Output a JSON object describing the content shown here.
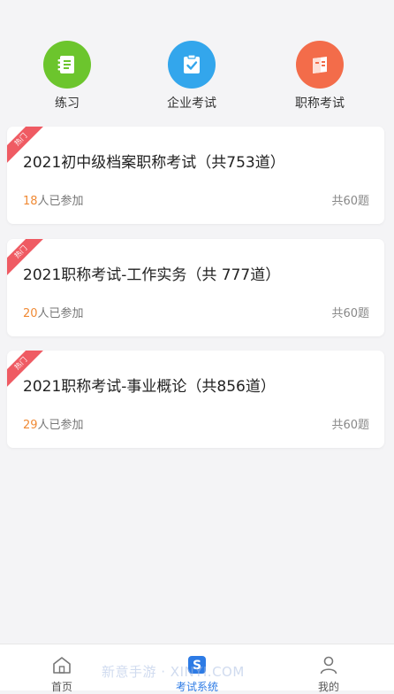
{
  "top_nav": {
    "items": [
      {
        "label": "练习",
        "icon": "notebook-icon",
        "color": "#6cc52d"
      },
      {
        "label": "企业考试",
        "icon": "clipboard-check-icon",
        "color": "#33a6ec"
      },
      {
        "label": "职称考试",
        "icon": "certificate-icon",
        "color": "#f36c4a"
      }
    ]
  },
  "exams": [
    {
      "badge": "热门",
      "title": "2021初中级档案职称考试（共753道）",
      "count": "18",
      "participants_suffix": "人已参加",
      "total": "共60题"
    },
    {
      "badge": "热门",
      "title": "2021职称考试-工作实务（共 777道）",
      "count": "20",
      "participants_suffix": "人已参加",
      "total": "共60题"
    },
    {
      "badge": "热门",
      "title": "2021职称考试-事业概论（共856道）",
      "count": "29",
      "participants_suffix": "人已参加",
      "total": "共60题"
    }
  ],
  "bottom_tabs": [
    {
      "label": "首页",
      "icon": "home-icon",
      "active": false
    },
    {
      "label": "考试系统",
      "icon": "exam-system-icon",
      "active": true
    },
    {
      "label": "我的",
      "icon": "user-icon",
      "active": false
    }
  ],
  "watermark": "新意手游 · XINYI.COM",
  "colors": {
    "accent": "#2d7be5",
    "highlight": "#f08a35",
    "badge": "#ef5b63"
  }
}
